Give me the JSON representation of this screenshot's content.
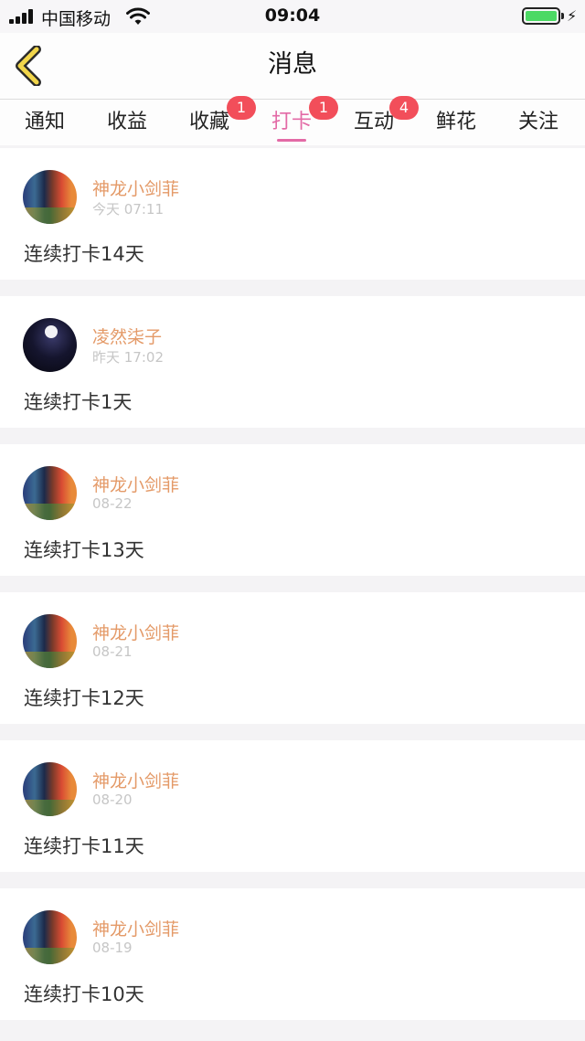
{
  "statusbar": {
    "carrier": "中国移动",
    "time": "09:04"
  },
  "header": {
    "title": "消息",
    "back_icon": "chevron-left-icon",
    "back_color": "#f2d64b"
  },
  "tabs": [
    {
      "label": "通知"
    },
    {
      "label": "收益"
    },
    {
      "label": "收藏",
      "badge": "1"
    },
    {
      "label": "打卡",
      "badge": "1",
      "active": true
    },
    {
      "label": "互动",
      "badge": "4"
    },
    {
      "label": "鲜花"
    },
    {
      "label": "关注"
    }
  ],
  "accent_color": "#e36aa6",
  "name_color": "#e49a68",
  "badge_color": "#f24e5a",
  "messages": [
    {
      "name": "神龙小剑菲",
      "time": "今天 07:11",
      "content": "连续打卡14天"
    },
    {
      "name": "凌然柒子",
      "time": "昨天 17:02",
      "content": "连续打卡1天"
    },
    {
      "name": "神龙小剑菲",
      "time": "08-22",
      "content": "连续打卡13天"
    },
    {
      "name": "神龙小剑菲",
      "time": "08-21",
      "content": "连续打卡12天"
    },
    {
      "name": "神龙小剑菲",
      "time": "08-20",
      "content": "连续打卡11天"
    },
    {
      "name": "神龙小剑菲",
      "time": "08-19",
      "content": "连续打卡10天"
    }
  ]
}
